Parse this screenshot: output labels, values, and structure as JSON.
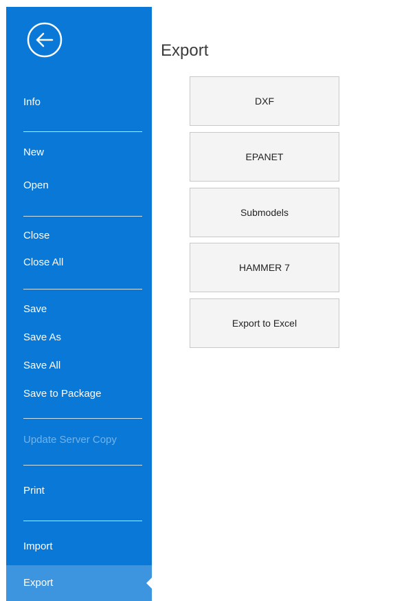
{
  "sidebar": {
    "back_icon": "back-arrow-circle-icon",
    "items": [
      {
        "label": "Info"
      },
      {
        "label": "New"
      },
      {
        "label": "Open"
      },
      {
        "label": "Close"
      },
      {
        "label": "Close All"
      },
      {
        "label": "Save"
      },
      {
        "label": "Save As"
      },
      {
        "label": "Save All"
      },
      {
        "label": "Save to Package"
      },
      {
        "label": "Update Server Copy",
        "disabled": true
      },
      {
        "label": "Print"
      },
      {
        "label": "Import"
      },
      {
        "label": "Export",
        "active": true
      }
    ]
  },
  "panel": {
    "title": "Export",
    "buttons": [
      {
        "label": "DXF"
      },
      {
        "label": "EPANET"
      },
      {
        "label": "Submodels"
      },
      {
        "label": "HAMMER 7"
      },
      {
        "label": "Export to Excel"
      }
    ]
  },
  "colors": {
    "sidebar_bg": "#0a78d7",
    "active_bg": "#3d95e0",
    "disabled_text": "#73b3ea",
    "button_bg": "#f4f4f4",
    "button_border": "#c8c8c8"
  }
}
